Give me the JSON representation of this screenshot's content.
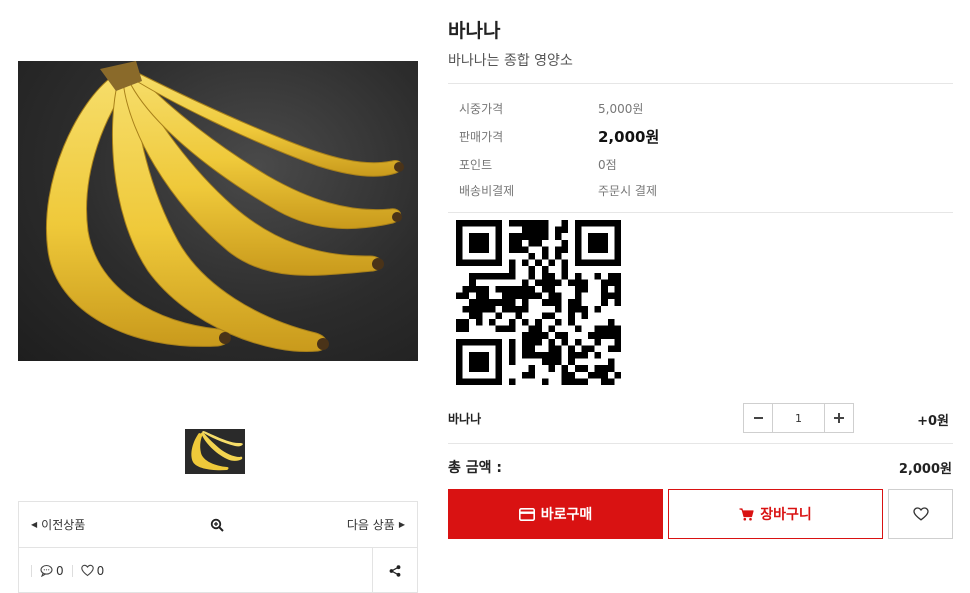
{
  "product": {
    "name": "바나나",
    "description": "바나나는 종합 영양소"
  },
  "info": [
    {
      "label": "시중가격",
      "value": "5,000원"
    },
    {
      "label": "판매가격",
      "value": "2,000원"
    },
    {
      "label": "포인트",
      "value": "0점"
    },
    {
      "label": "배송비결제",
      "value": "주문시 결제"
    }
  ],
  "option": {
    "name": "바나나",
    "quantity": "1",
    "price": "+0원"
  },
  "total": {
    "label": "총 금액 :",
    "value": "2,000원"
  },
  "buttons": {
    "buy": "바로구매",
    "cart": "장바구니"
  },
  "nav": {
    "prev": "이전상품",
    "next": "다음 상품"
  },
  "stats": {
    "comments": "0",
    "likes": "0"
  },
  "colors": {
    "accent": "#d91212"
  },
  "icons": [
    "zoom-in-icon",
    "comment-icon",
    "heart-icon",
    "share-icon",
    "card-icon",
    "cart-icon",
    "minus-icon",
    "plus-icon"
  ]
}
